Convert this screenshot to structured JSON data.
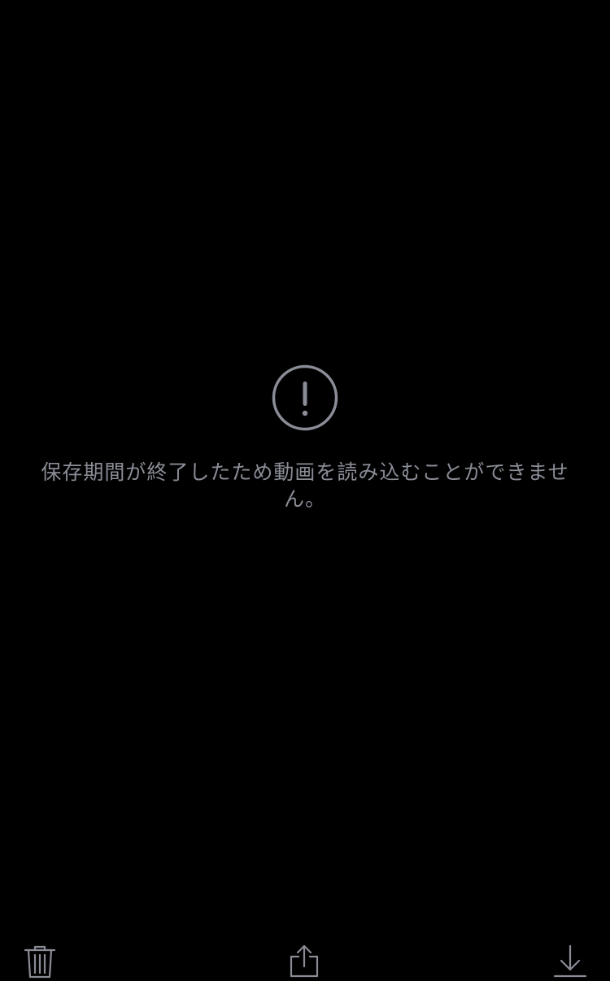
{
  "error": {
    "icon": "exclamation-circle-icon",
    "message": "保存期間が終了したため動画を読み込むことができません。"
  },
  "toolbar": {
    "buttons": [
      {
        "id": "delete",
        "icon": "trash-icon"
      },
      {
        "id": "share",
        "icon": "share-icon"
      },
      {
        "id": "download",
        "icon": "download-icon"
      }
    ]
  },
  "colors": {
    "background": "#000000",
    "icon_gray": "#8a8c96",
    "text_gray": "#8a8c96"
  }
}
